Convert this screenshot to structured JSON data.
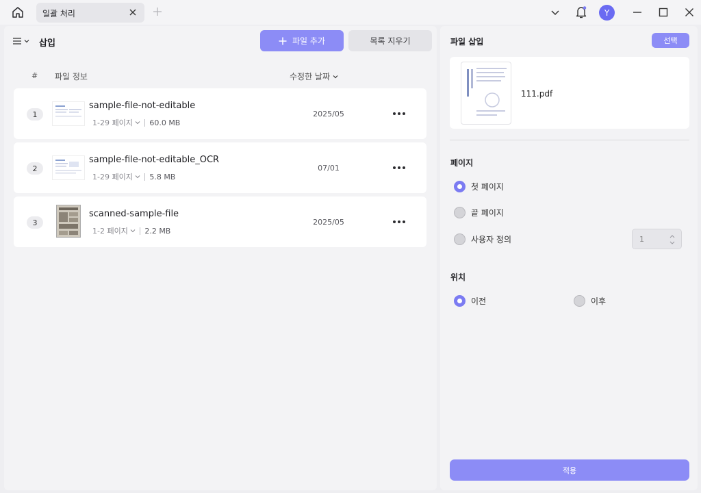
{
  "titlebar": {
    "tab_label": "일괄 처리",
    "avatar_letter": "Y"
  },
  "left": {
    "title": "삽입",
    "add_file_label": "파일 추가",
    "clear_list_label": "목록 지우기",
    "columns": {
      "index": "#",
      "info": "파일 정보",
      "date": "수정한 날짜"
    },
    "files": [
      {
        "index": "1",
        "name": "sample-file-not-editable",
        "pages": "1-29 페이지",
        "size": "60.0 MB",
        "date": "2025/05"
      },
      {
        "index": "2",
        "name": "sample-file-not-editable_OCR",
        "pages": "1-29 페이지",
        "size": "5.8 MB",
        "date": "07/01"
      },
      {
        "index": "3",
        "name": "scanned-sample-file",
        "pages": "1-2 페이지",
        "size": "2.2 MB",
        "date": "2025/05"
      }
    ]
  },
  "right": {
    "title": "파일 삽입",
    "select_label": "선택",
    "insert_file_name": "111.pdf",
    "page_section": "페이지",
    "page_options": [
      "첫 페이지",
      "끝 페이지",
      "사용자 정의"
    ],
    "page_selected": 0,
    "custom_value": "1",
    "position_section": "위치",
    "position_options": [
      "이전",
      "이후"
    ],
    "position_selected": 0,
    "apply_label": "적용"
  },
  "colors": {
    "accent": "#8c8cf6",
    "radio_on": "#7b7bf2"
  }
}
